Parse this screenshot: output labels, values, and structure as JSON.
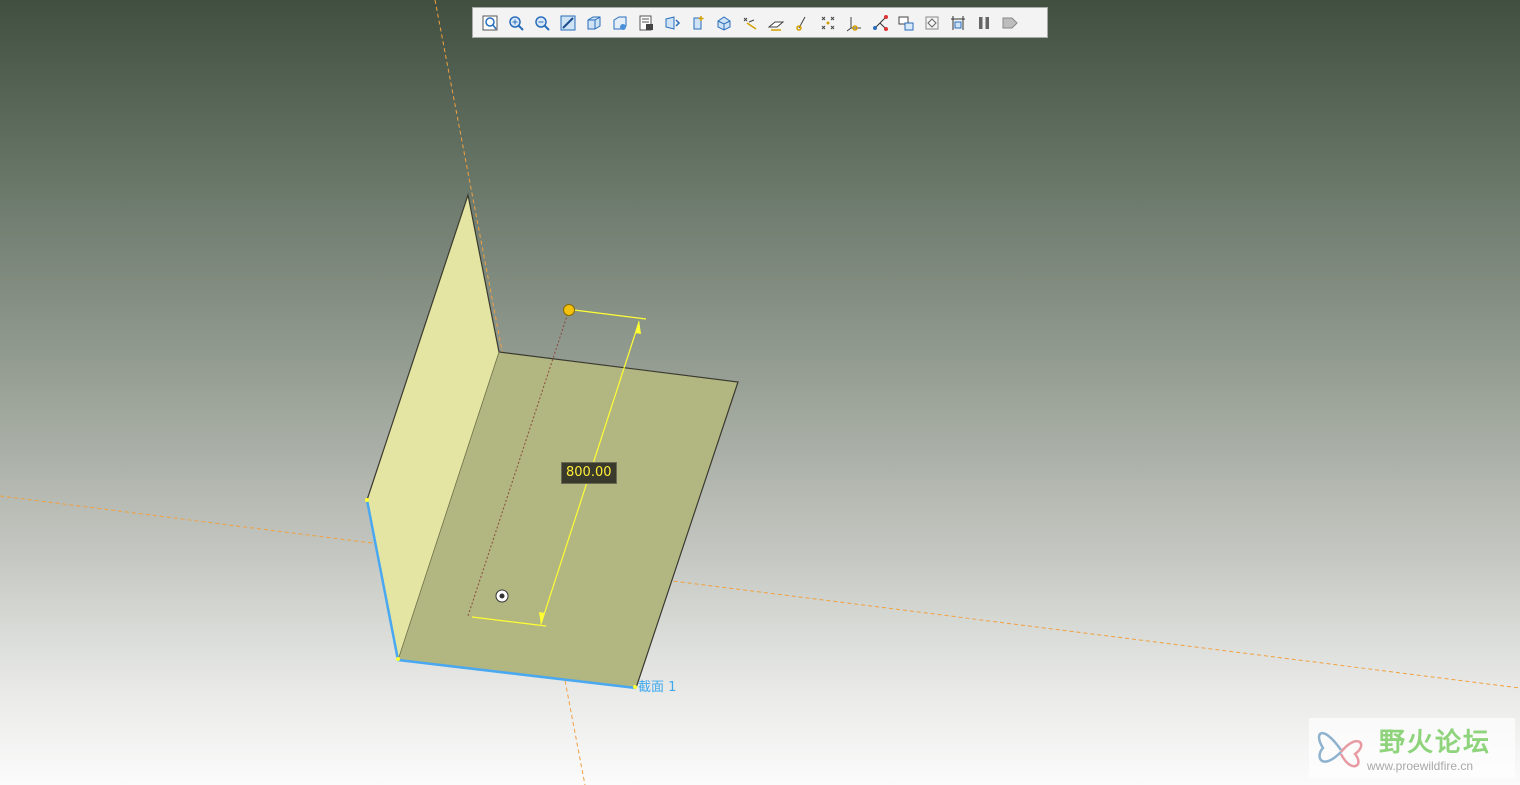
{
  "toolbar": {
    "items": [
      {
        "name": "refit-view-icon"
      },
      {
        "name": "zoom-in-icon"
      },
      {
        "name": "zoom-out-icon"
      },
      {
        "name": "repaint-icon"
      },
      {
        "name": "display-style-icon"
      },
      {
        "name": "saved-views-icon"
      },
      {
        "name": "view-manager-icon"
      },
      {
        "name": "perspective-view-icon"
      },
      {
        "name": "spin-center-icon"
      },
      {
        "name": "annotation-display-icon"
      },
      {
        "name": "plane-display-icon"
      },
      {
        "name": "axis-display-icon"
      },
      {
        "name": "point-display-icon"
      },
      {
        "name": "csys-display-icon"
      },
      {
        "name": "sketch-display-icon"
      },
      {
        "name": "appearance-icon"
      },
      {
        "name": "layer-icon"
      },
      {
        "name": "regenerate-icon"
      },
      {
        "name": "analysis-icon"
      },
      {
        "name": "pause-icon"
      },
      {
        "name": "exit-icon"
      }
    ]
  },
  "model": {
    "dimension_value": "800.00",
    "section_label": "截面 1"
  },
  "watermark": {
    "title": "野火论坛",
    "url": "www.proewildfire.cn"
  },
  "colors": {
    "wall": "#e4e5a2",
    "base": "#b2b680",
    "edge_selected": "#49a8f0",
    "dimension": "#ffff33",
    "datum": "#f0a040"
  }
}
